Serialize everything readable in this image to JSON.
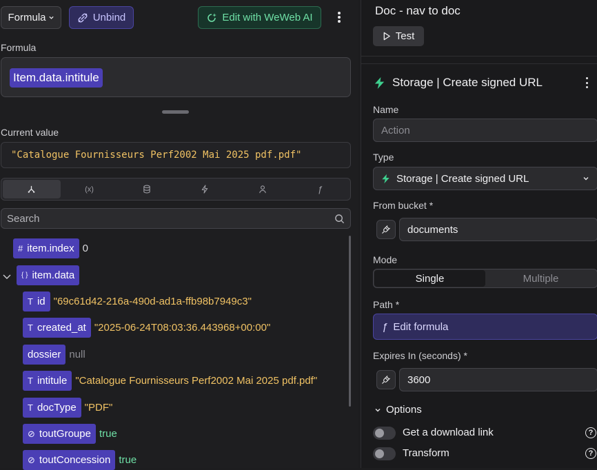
{
  "toolbar": {
    "formula_label": "Formula",
    "unbind_label": "Unbind",
    "ai_label": "Edit with WeWeb AI"
  },
  "formula": {
    "section_label": "Formula",
    "expression": "Item.data.intitule"
  },
  "current_value": {
    "label": "Current value",
    "value": "\"Catalogue Fournisseurs Perf2002 Mai 2025 pdf.pdf\""
  },
  "explorer_tabs": [
    {
      "icon": "tree-icon",
      "active": true
    },
    {
      "icon": "variable-icon",
      "active": false
    },
    {
      "icon": "database-icon",
      "active": false
    },
    {
      "icon": "bolt-icon",
      "active": false
    },
    {
      "icon": "user-icon",
      "active": false
    },
    {
      "icon": "function-icon",
      "active": false
    }
  ],
  "search": {
    "placeholder": "Search"
  },
  "tree": {
    "index_key": "item.index",
    "index_value": "0",
    "data_key": "item.data",
    "id_key": "id",
    "id_value": "\"69c61d42-216a-490d-ad1a-ffb98b7949c3\"",
    "created_key": "created_at",
    "created_value": "\"2025-06-24T08:03:36.443968+00:00\"",
    "dossier_key": "dossier",
    "dossier_value": "null",
    "intitule_key": "intitule",
    "intitule_value": "\"Catalogue Fournisseurs Perf2002 Mai 2025 pdf.pdf\"",
    "doctype_key": "docType",
    "doctype_value": "\"PDF\"",
    "toutgroupe_key": "toutGroupe",
    "toutgroupe_value": "true",
    "toutconcession_key": "toutConcession",
    "toutconcession_value": "true"
  },
  "workflow": {
    "title": "Doc - nav to doc",
    "test_label": "Test"
  },
  "action": {
    "title": "Storage | Create signed URL",
    "name_label": "Name",
    "name_placeholder": "Action",
    "type_label": "Type",
    "type_value": "Storage | Create signed URL",
    "bucket_label": "From bucket",
    "bucket_value": "documents",
    "mode_label": "Mode",
    "mode_single": "Single",
    "mode_multiple": "Multiple",
    "path_label": "Path",
    "path_button": "Edit formula",
    "expires_label": "Expires In (seconds)",
    "expires_value": "3600",
    "options_label": "Options",
    "download_label": "Get a download link",
    "transform_label": "Transform",
    "required_mark": "*",
    "help_glyph": "?"
  },
  "colors": {
    "accent_purple": "#4b3fb5",
    "ai_green": "#6fe0a6",
    "string_value": "#f0c264"
  }
}
